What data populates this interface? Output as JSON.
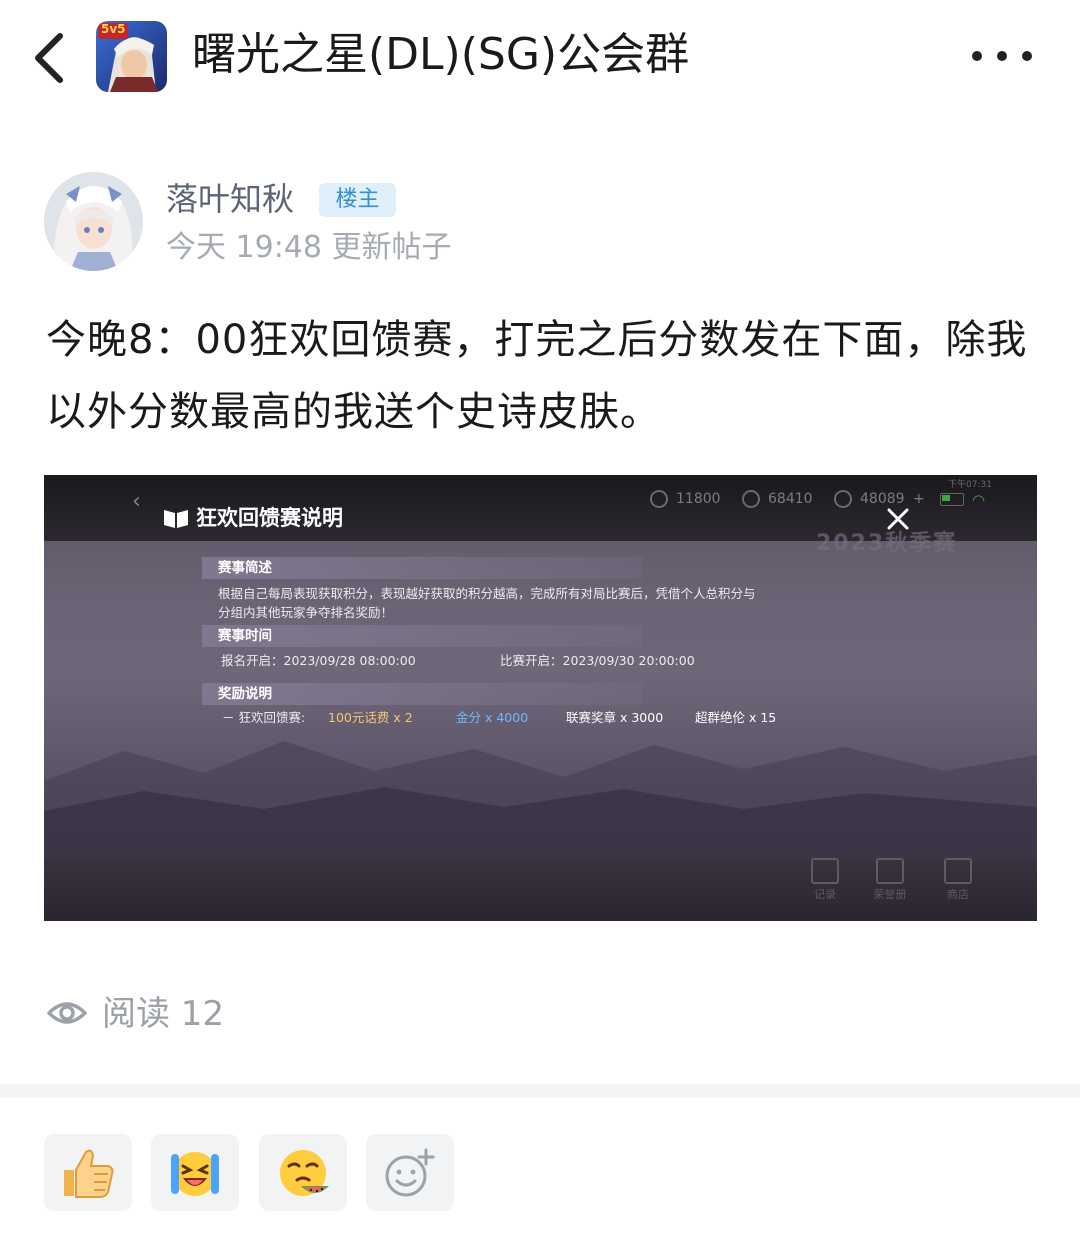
{
  "header": {
    "back_icon": "chevron-left-icon",
    "group_icon": "game-group-avatar",
    "group_badge": "5v5",
    "title": "曙光之星(DL)(SG)公会群",
    "more_icon": "more-dots-icon"
  },
  "post": {
    "author": "落叶知秋",
    "owner_badge": "楼主",
    "meta": "今天 19:48 更新帖子",
    "content": "今晚8：00狂欢回馈赛，打完之后分数发在下面，除我以外分数最高的我送个史诗皮肤。",
    "read_label": "阅读 12"
  },
  "screenshot": {
    "title": "狂欢回馈赛说明",
    "resources": [
      "11800",
      "68410",
      "48089"
    ],
    "plus": "+",
    "clock": "下午07:31",
    "bg_title": "2023秋季赛",
    "sections": [
      {
        "title": "赛事简述",
        "lines": [
          "根据自己每局表现获取积分，表现越好获取的积分越高，完成所有对局比赛后，凭借个人总积分与",
          "分组内其他玩家争夺排名奖励！"
        ]
      },
      {
        "title": "赛事时间",
        "signup": "报名开启：2023/09/28  08:00:00",
        "start": "比赛开启：2023/09/30  20:00:00"
      },
      {
        "title": "奖励说明"
      }
    ],
    "reward_label": "－ 狂欢回馈赛:",
    "rewards": [
      "100元话费 x 2",
      "金分 x 4000",
      "联赛奖章 x 3000",
      "超群绝伦 x 15"
    ],
    "bottom_buttons": [
      "记录",
      "荣誉册",
      "商店"
    ],
    "colors": {
      "reward1": "#f6c77a",
      "reward2": "#6fb8ff",
      "reward3": "#ffffff",
      "reward4": "#ffffff"
    }
  },
  "reactions": [
    {
      "name": "thumbs-up-emoji"
    },
    {
      "name": "laughing-tears-emoji"
    },
    {
      "name": "watermelon-smirk-emoji"
    },
    {
      "name": "add-emoji-icon"
    }
  ],
  "colors": {
    "owner_badge_bg": "#dff0fb",
    "owner_badge_text": "#2f8fd8",
    "meta_gray": "#a6abb3"
  }
}
